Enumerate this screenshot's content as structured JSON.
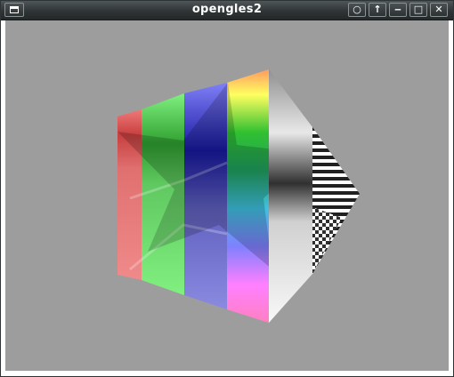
{
  "window": {
    "title": "opengles2",
    "buttons": [
      {
        "name": "pin-button",
        "icon": "circle-icon",
        "glyph": "○"
      },
      {
        "name": "raise-button",
        "icon": "arrow-up-icon",
        "glyph": "↑"
      },
      {
        "name": "minimize-button",
        "icon": "minimize-icon",
        "glyph": "‒"
      },
      {
        "name": "maximize-button",
        "icon": "maximize-icon",
        "glyph": "□"
      },
      {
        "name": "close-button",
        "icon": "close-icon",
        "glyph": "✕"
      }
    ]
  },
  "colors": {
    "client_background": "#9d9d9d",
    "titlebar": "#2f3436",
    "red_band": "#f08080",
    "green_band": "#80f080",
    "blue_band": "#8080f0"
  }
}
